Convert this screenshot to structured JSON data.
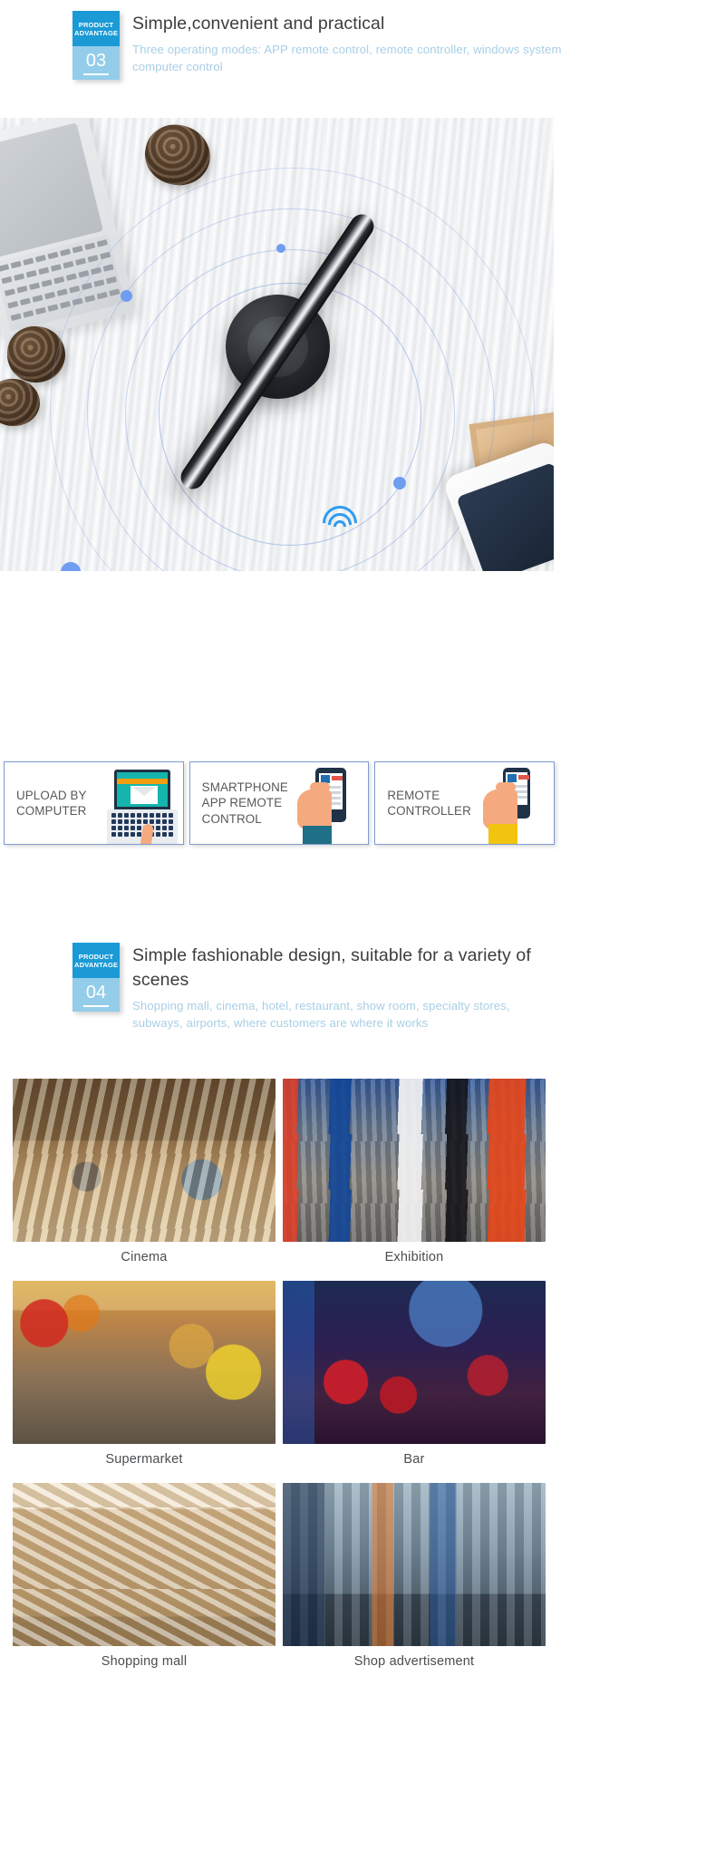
{
  "sections": [
    {
      "badge_line1": "PRODUCT",
      "badge_line2": "ADVANTAGE",
      "number": "03",
      "title": "Simple,convenient and practical",
      "subtitle": "Three operating modes: APP remote control, remote controller, windows system computer control"
    },
    {
      "badge_line1": "PRODUCT",
      "badge_line2": "ADVANTAGE",
      "number": "04",
      "title": "Simple fashionable design, suitable for a variety of scenes",
      "subtitle": "Shopping mall, cinema, hotel, restaurant, show room, specialty stores, subways, airports, where customers are where it works"
    }
  ],
  "mode_cards": [
    {
      "label": "UPLOAD BY COMPUTER",
      "icon": "laptop-upload-icon"
    },
    {
      "label": "SMARTPHONE APP REMOTE CONTROL",
      "icon": "hand-holding-phone-icon"
    },
    {
      "label": "REMOTE CONTROLLER",
      "icon": "hand-holding-remote-icon"
    }
  ],
  "scene_grid": [
    [
      {
        "caption": "Cinema",
        "photo": "cinema-interior-photo"
      },
      {
        "caption": "Exhibition",
        "photo": "exhibition-hall-photo"
      }
    ],
    [
      {
        "caption": "Supermarket",
        "photo": "supermarket-aisle-photo"
      },
      {
        "caption": "Bar",
        "photo": "bar-interior-photo"
      }
    ],
    [
      {
        "caption": "Shopping mall",
        "photo": "shopping-mall-escalator-photo"
      },
      {
        "caption": "Shop advertisement",
        "photo": "shop-storefront-photo"
      }
    ]
  ],
  "hero": {
    "alt": "hologram-fan-on-desk-photo"
  },
  "colors": {
    "badge_top": "#1b9ad6",
    "badge_bottom": "#93cdea",
    "title_text": "#3d3d3d",
    "subtitle_text": "#a8cfe6",
    "card_border": "#7f9bd0",
    "ring_blue": "#7e9fe0",
    "wifi_blue": "#2e9bf0"
  }
}
